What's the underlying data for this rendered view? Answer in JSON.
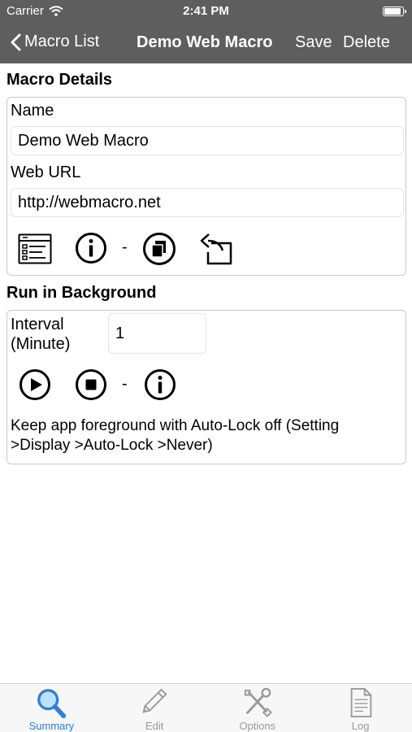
{
  "status": {
    "carrier": "Carrier",
    "time": "2:41 PM",
    "battery_level": 0.95
  },
  "nav": {
    "back_label": "Macro List",
    "title": "Demo Web Macro",
    "save_label": "Save",
    "delete_label": "Delete"
  },
  "details": {
    "section_title": "Macro Details",
    "name_label": "Name",
    "name_value": "Demo Web Macro",
    "url_label": "Web URL",
    "url_value": "http://webmacro.net",
    "separator": "-"
  },
  "background": {
    "section_title": "Run in Background",
    "interval_label_line1": "Interval",
    "interval_label_line2": "(Minute)",
    "interval_value": "1",
    "separator": "-",
    "note_line1": "Keep app foreground with Auto-Lock off (Setting",
    "note_line2": ">Display >Auto-Lock >Never)"
  },
  "tabs": [
    {
      "label": "Summary",
      "icon": "magnifier-icon",
      "active": true
    },
    {
      "label": "Edit",
      "icon": "pencil-icon",
      "active": false
    },
    {
      "label": "Options",
      "icon": "tools-icon",
      "active": false
    },
    {
      "label": "Log",
      "icon": "document-icon",
      "active": false
    }
  ],
  "colors": {
    "nav_bg": "#5e5e5e",
    "tab_active": "#2e7fd9",
    "tab_inactive": "#9a9a9a"
  }
}
